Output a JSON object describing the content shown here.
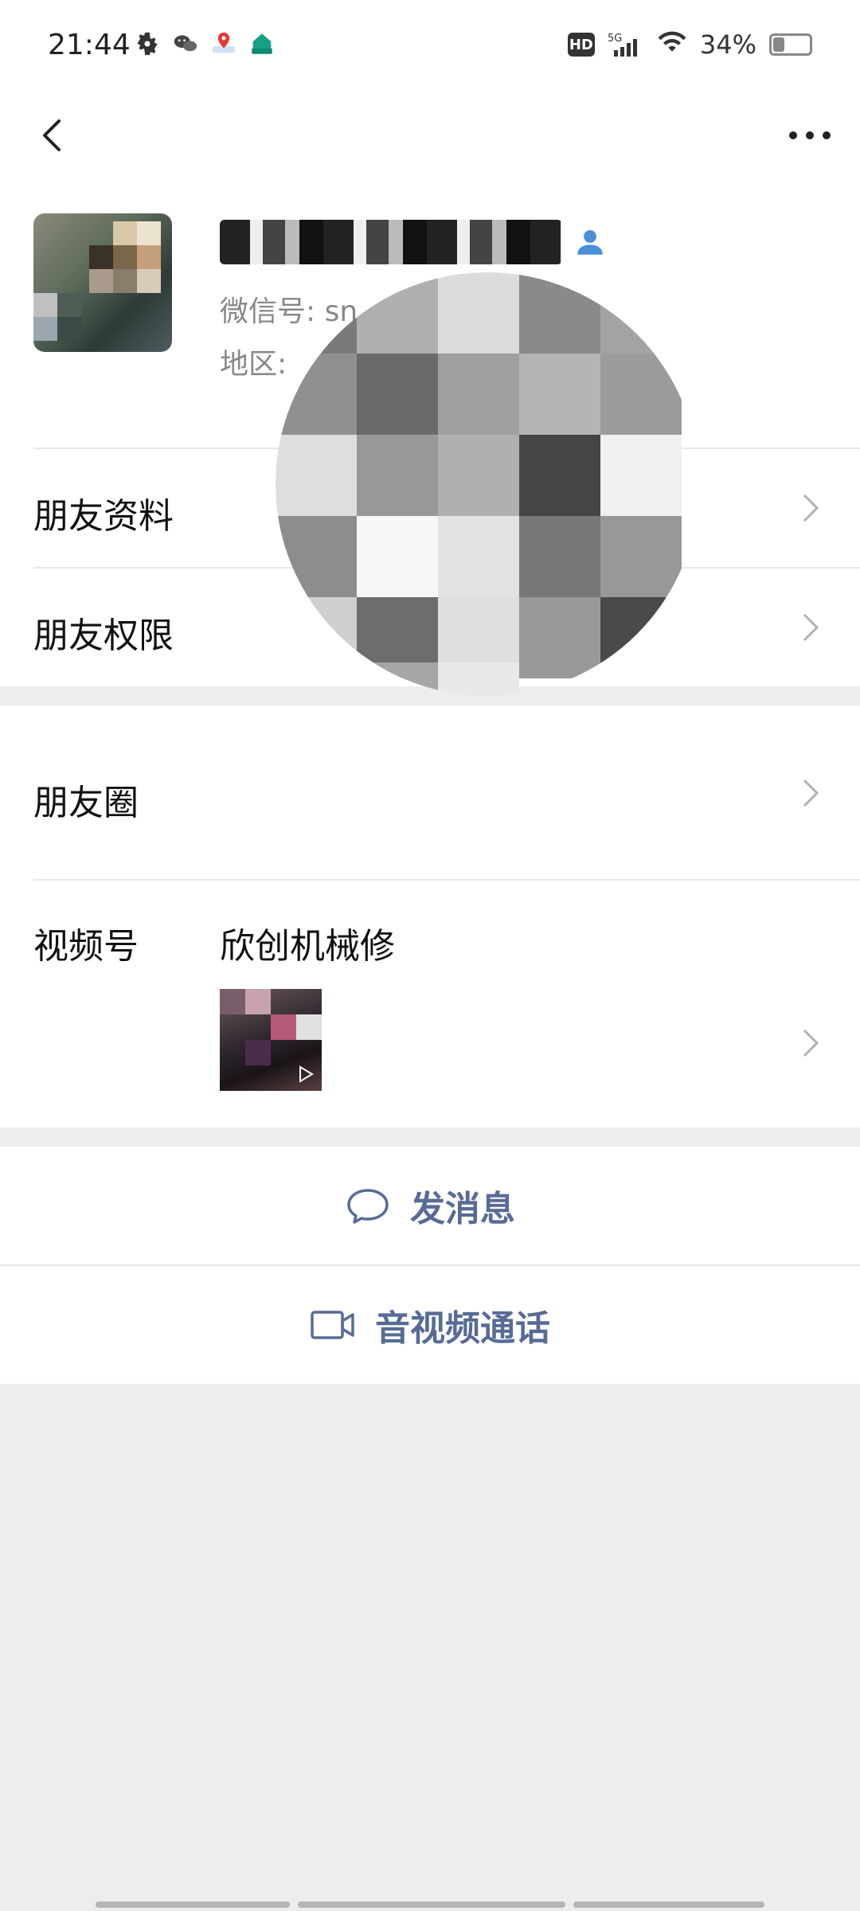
{
  "status_bar": {
    "time": "21:44",
    "battery": "34%",
    "network": "5G",
    "hd_label": "HD",
    "left_icons": [
      "settings-icon",
      "wechat-icon",
      "map-pin-icon",
      "app-store-icon"
    ]
  },
  "nav": {
    "back_icon": "chevron-left-icon",
    "more_icon": "more-dots-icon"
  },
  "profile": {
    "name": "",
    "wechat_id_label": "微信号: ",
    "wechat_id_value": "sn",
    "region_label": "地区: ",
    "region_value": "",
    "verify_icon": "verified-person-icon"
  },
  "rows": {
    "friend_profile": "朋友资料",
    "friend_permissions": "朋友权限",
    "moments": "朋友圈",
    "channels": "视频号",
    "channels_name": "欣创机械修"
  },
  "actions": {
    "send_message": "发消息",
    "video_call": "音视频通话"
  },
  "colors": {
    "link_blue": "#576b95",
    "page_bg": "#ededed",
    "divider": "#e7e7e7",
    "verify_blue": "#4a90d9"
  }
}
